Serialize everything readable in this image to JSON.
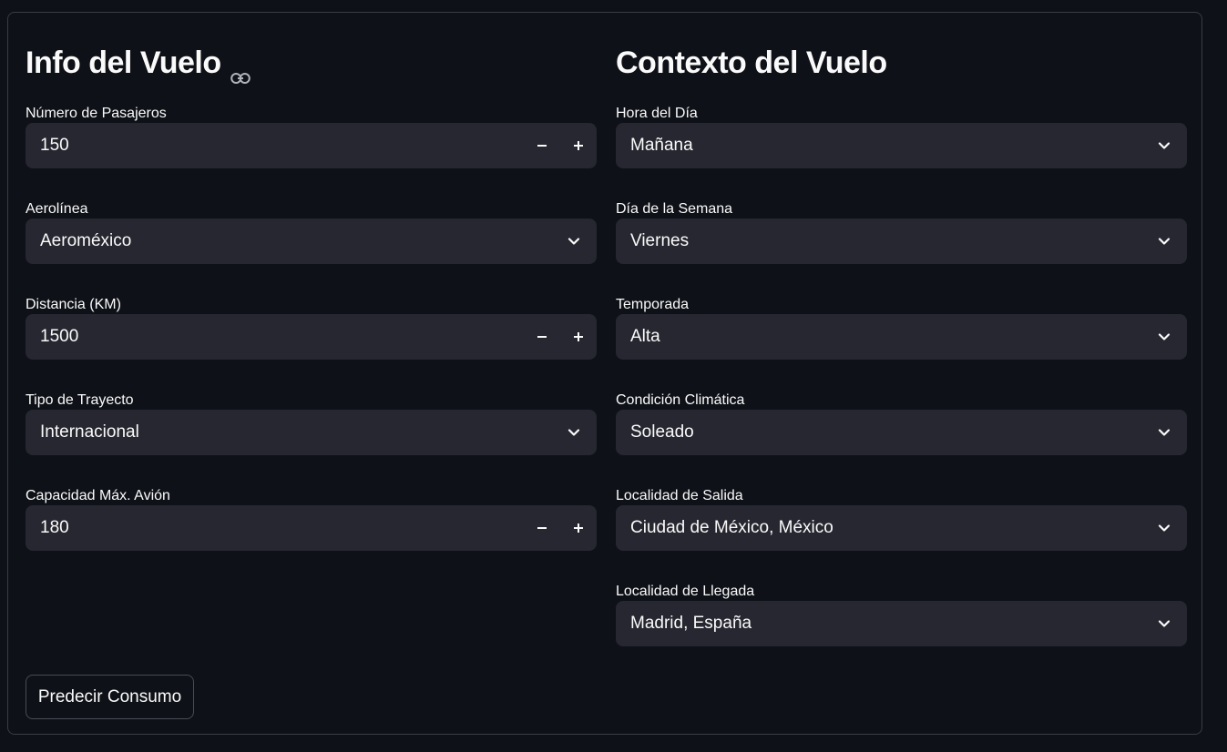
{
  "left": {
    "title": "Info del Vuelo",
    "icon": "link-icon",
    "fields": [
      {
        "label": "Número de Pasajeros",
        "value": "150",
        "kind": "number"
      },
      {
        "label": "Aerolínea",
        "value": "Aeroméxico",
        "kind": "select"
      },
      {
        "label": "Distancia (KM)",
        "value": "1500",
        "kind": "number"
      },
      {
        "label": "Tipo de Trayecto",
        "value": "Internacional",
        "kind": "select"
      },
      {
        "label": "Capacidad Máx. Avión",
        "value": "180",
        "kind": "number"
      }
    ]
  },
  "right": {
    "title": "Contexto del Vuelo",
    "fields": [
      {
        "label": "Hora del Día",
        "value": "Mañana",
        "kind": "select"
      },
      {
        "label": "Día de la Semana",
        "value": "Viernes",
        "kind": "select"
      },
      {
        "label": "Temporada",
        "value": "Alta",
        "kind": "select"
      },
      {
        "label": "Condición Climática",
        "value": "Soleado",
        "kind": "select"
      },
      {
        "label": "Localidad de Salida",
        "value": "Ciudad de México, México",
        "kind": "select"
      },
      {
        "label": "Localidad de Llegada",
        "value": "Madrid, España",
        "kind": "select"
      }
    ]
  },
  "submit_label": "Predecir Consumo",
  "colors": {
    "background": "#0e1117",
    "input_bg": "#262730",
    "text": "#fafafa",
    "border": "#3a3c45"
  }
}
